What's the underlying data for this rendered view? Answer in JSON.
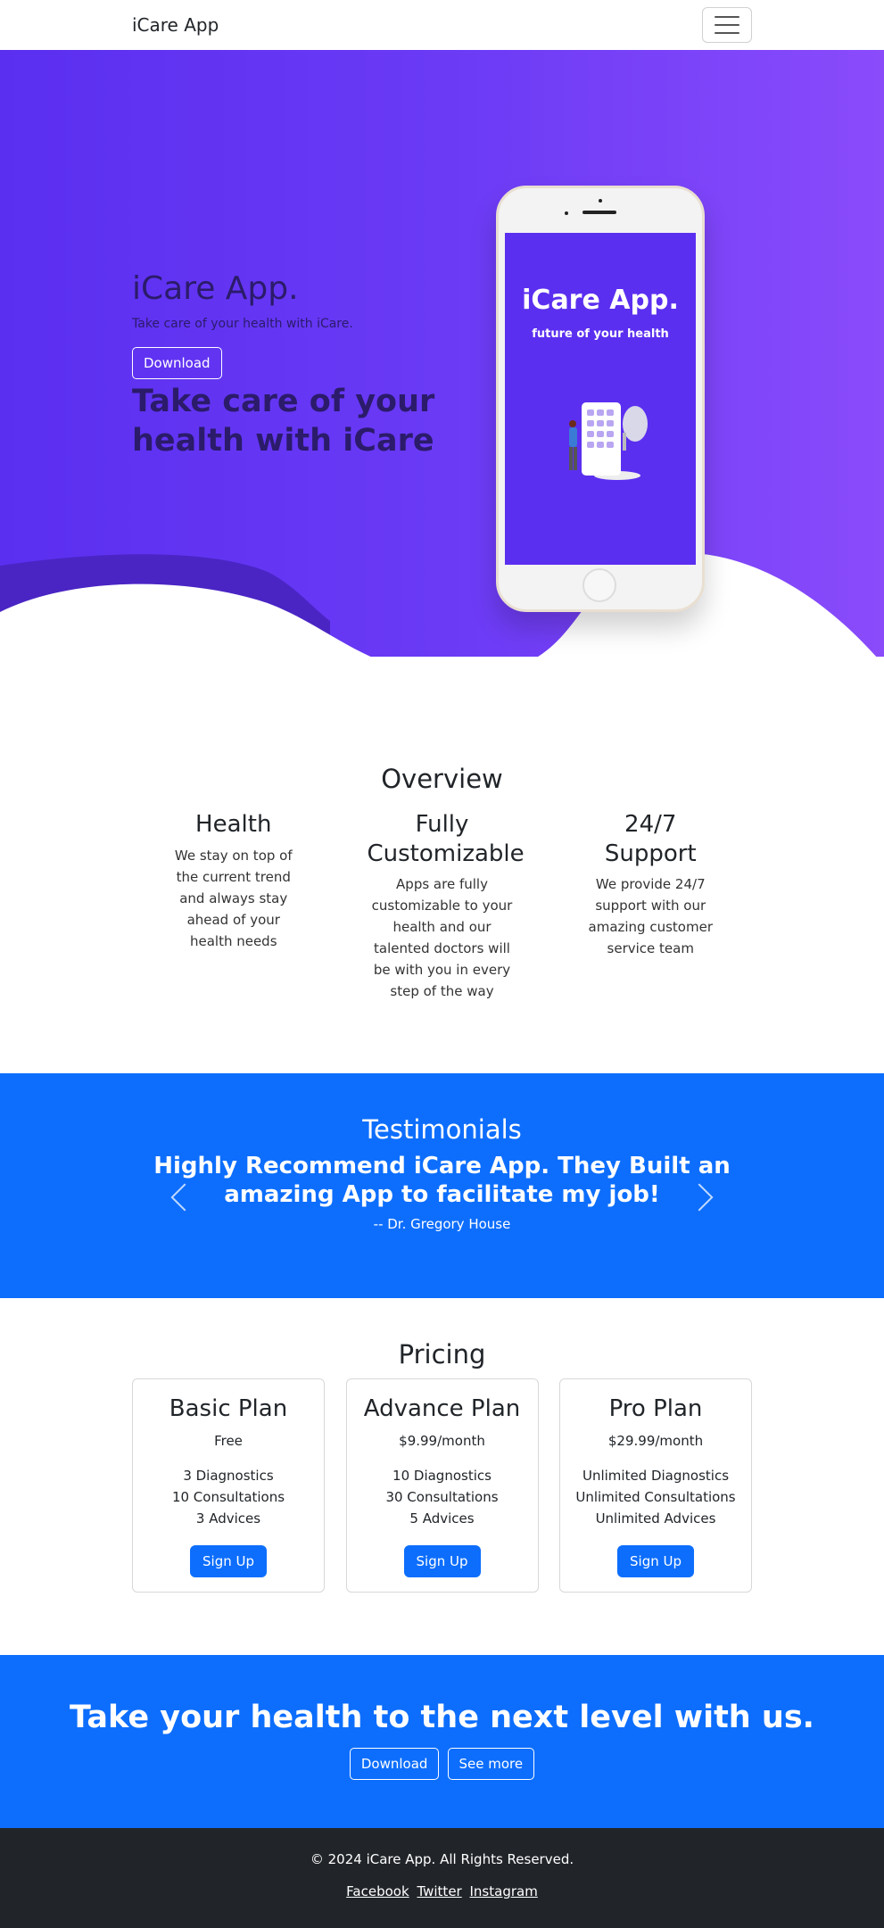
{
  "navbar": {
    "brand": "iCare App",
    "menu_icon": "hamburger-icon"
  },
  "hero": {
    "title": "iCare App.",
    "subtitle": "Take care of your health with iCare.",
    "download_label": "Download",
    "tagline": "Take care of your health with iCare",
    "phone_screen_title": "iCare App.",
    "phone_screen_subtitle": "future of your health",
    "colors": {
      "gradient_start": "#5b2ff0",
      "gradient_end": "#8a4bfb"
    }
  },
  "overview": {
    "title": "Overview",
    "features": [
      {
        "title": "Health",
        "text": "We stay on top of the current trend and always stay ahead of your health needs"
      },
      {
        "title": "Fully Customizable",
        "text": "Apps are fully customizable to your health and our talented doctors will be with you in every step of the way"
      },
      {
        "title": "24/7 Support",
        "text": "We provide 24/7 support with our amazing customer service team"
      }
    ]
  },
  "testimonials": {
    "title": "Testimonials",
    "quote": "Highly Recommend iCare App. They Built an amazing App to facilitate my job!",
    "author": "-- Dr. Gregory House",
    "prev_icon": "chevron-left-icon",
    "next_icon": "chevron-right-icon",
    "accent": "#0d6efd"
  },
  "pricing": {
    "title": "Pricing",
    "plans": [
      {
        "name": "Basic Plan",
        "price": "Free",
        "features": [
          "3 Diagnostics",
          "10 Consultations",
          "3 Advices"
        ],
        "cta": "Sign Up"
      },
      {
        "name": "Advance Plan",
        "price": "$9.99/month",
        "features": [
          "10 Diagnostics",
          "30 Consultations",
          "5 Advices"
        ],
        "cta": "Sign Up"
      },
      {
        "name": "Pro Plan",
        "price": "$29.99/month",
        "features": [
          "Unlimited Diagnostics",
          "Unlimited Consultations",
          "Unlimited Advices"
        ],
        "cta": "Sign Up"
      }
    ]
  },
  "cta": {
    "title": "Take your health to the next level with us.",
    "download_label": "Download",
    "see_more_label": "See more"
  },
  "footer": {
    "copyright": "© 2024 iCare App. All Rights Reserved.",
    "links": [
      "Facebook",
      "Twitter",
      "Instagram"
    ]
  }
}
